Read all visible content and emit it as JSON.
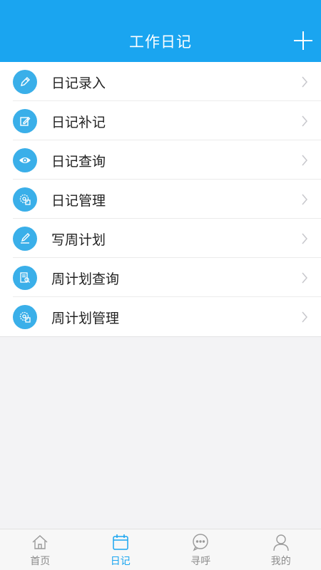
{
  "header": {
    "title": "工作日记",
    "add_icon": "plus-icon"
  },
  "menu": {
    "items": [
      {
        "label": "日记录入",
        "icon": "pencil-icon"
      },
      {
        "label": "日记补记",
        "icon": "edit-note-icon"
      },
      {
        "label": "日记查询",
        "icon": "eye-icon"
      },
      {
        "label": "日记管理",
        "icon": "gear-doc-icon"
      },
      {
        "label": "写周计划",
        "icon": "pencil-square-icon"
      },
      {
        "label": "周计划查询",
        "icon": "doc-search-icon"
      },
      {
        "label": "周计划管理",
        "icon": "gear-doc-icon"
      }
    ]
  },
  "tabbar": {
    "tabs": [
      {
        "label": "首页",
        "icon": "home-icon",
        "active": false
      },
      {
        "label": "日记",
        "icon": "calendar-icon",
        "active": true
      },
      {
        "label": "寻呼",
        "icon": "chat-icon",
        "active": false
      },
      {
        "label": "我的",
        "icon": "user-icon",
        "active": false
      }
    ]
  },
  "colors": {
    "primary": "#1aa5f0",
    "icon_bg": "#3aafe9",
    "inactive": "#8c8c8c"
  }
}
